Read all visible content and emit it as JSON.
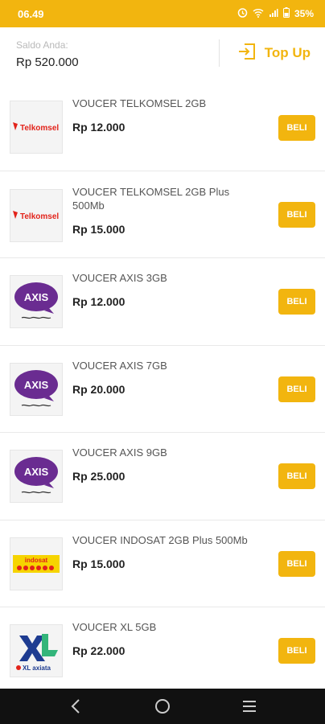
{
  "status": {
    "time": "06.49",
    "battery": "35%"
  },
  "header": {
    "saldo_label": "Saldo Anda:",
    "saldo_value": "Rp 520.000",
    "topup_label": "Top Up"
  },
  "items": [
    {
      "name": "VOUCER TELKOMSEL 2GB",
      "price": "Rp 12.000",
      "button": "BELI",
      "logo": "telkomsel",
      "logo_text": "Telkomsel"
    },
    {
      "name": "VOUCER TELKOMSEL 2GB Plus 500Mb",
      "price": "Rp 15.000",
      "button": "BELI",
      "logo": "telkomsel",
      "logo_text": "Telkomsel"
    },
    {
      "name": "VOUCER AXIS 3GB",
      "price": "Rp 12.000",
      "button": "BELI",
      "logo": "axis",
      "logo_text": "AXIS"
    },
    {
      "name": "VOUCER AXIS 7GB",
      "price": "Rp 20.000",
      "button": "BELI",
      "logo": "axis",
      "logo_text": "AXIS"
    },
    {
      "name": "VOUCER AXIS 9GB",
      "price": "Rp 25.000",
      "button": "BELI",
      "logo": "axis",
      "logo_text": "AXIS"
    },
    {
      "name": "VOUCER INDOSAT 2GB Plus 500Mb",
      "price": "Rp 15.000",
      "button": "BELI",
      "logo": "indosat",
      "logo_text": "indosat"
    },
    {
      "name": "VOUCER XL 5GB",
      "price": "Rp 22.000",
      "button": "BELI",
      "logo": "xl",
      "logo_text": "XL axiata"
    }
  ],
  "colors": {
    "accent": "#f2b50f",
    "axis_purple": "#6a2c91",
    "telkomsel_red": "#e2231a",
    "xl_blue": "#1e3c91",
    "xl_green": "#33b57a"
  }
}
